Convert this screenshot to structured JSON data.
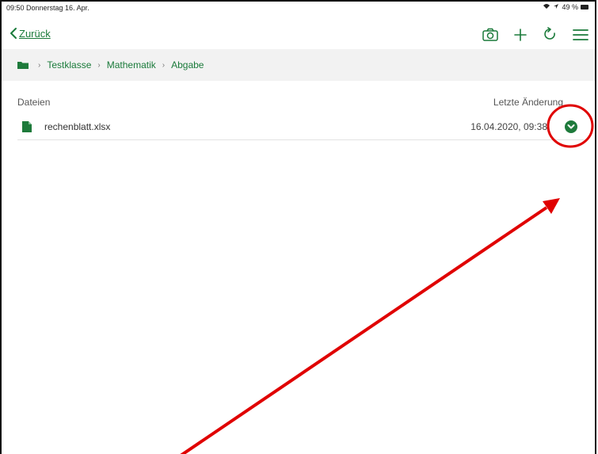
{
  "status": {
    "time_date": "09:50  Donnerstag 16. Apr.",
    "battery": "49 %"
  },
  "nav": {
    "back_label": "Zurück",
    "actions": [
      "camera-icon",
      "plus-icon",
      "refresh-icon",
      "menu-icon"
    ]
  },
  "breadcrumb": {
    "items": [
      "Testklasse",
      "Mathematik",
      "Abgabe"
    ]
  },
  "table": {
    "columns": {
      "files": "Dateien",
      "modified": "Letzte Änderung"
    },
    "rows": [
      {
        "name": "rechenblatt.xlsx",
        "modified": "16.04.2020, 09:38"
      }
    ]
  },
  "colors": {
    "accent": "#1e7a3b",
    "annotation": "#e00000"
  }
}
